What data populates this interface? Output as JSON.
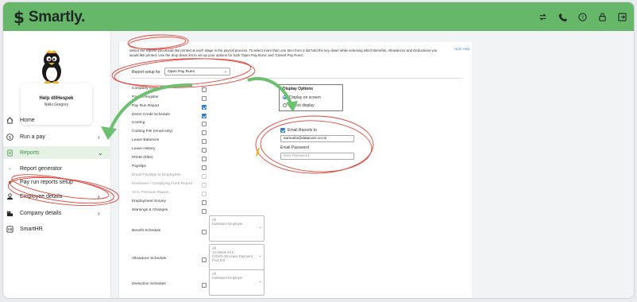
{
  "app": {
    "name": "Smartly."
  },
  "profile": {
    "company": "Help dllHespek",
    "user": "Nikki Gregory"
  },
  "nav": [
    {
      "label": "Home",
      "icon": "home-icon"
    },
    {
      "label": "Run a pay",
      "icon": "dollar-icon",
      "chevron": "›"
    },
    {
      "label": "Reports",
      "icon": "document-icon",
      "chevron": "⌄"
    },
    {
      "label": "Report generator"
    },
    {
      "label": "Pay run reports setup"
    },
    {
      "label": "Employee details",
      "icon": "person-icon",
      "chevron": "›"
    },
    {
      "label": "Company details",
      "icon": "building-icon",
      "chevron": "›"
    },
    {
      "label": "SmartHR",
      "icon": "hr-icon"
    }
  ],
  "content": {
    "intro": "Select the reports you would like printed at each stage in the payroll process. To select more than one item from a list hold the key down while selecting which Benefits, Allowances and Deductions you would like printed. Use the drop down list to set up your options for both 'Open Pay Runs' and 'Closed Pay Runs'.",
    "hide_help": "Hide Help",
    "setup_label": "Report setup for",
    "setup_value": "Open Pay Runs",
    "reports": [
      {
        "label": "Company Controls",
        "checked": false
      },
      {
        "label": "Payroll Register",
        "checked": false
      },
      {
        "label": "Pay Run Report",
        "checked": true
      },
      {
        "label": "Direct Credit Schedule",
        "checked": true
      },
      {
        "label": "Costing",
        "checked": false
      },
      {
        "label": "Costing File (email only)",
        "checked": false
      },
      {
        "label": "Leave Balances",
        "checked": false
      },
      {
        "label": "Leave History",
        "checked": false
      },
      {
        "label": "IR348 (Elite)",
        "checked": false
      },
      {
        "label": "Payslips",
        "checked": false
      },
      {
        "label": "Email Payslips to Employees",
        "checked": false,
        "disabled": true
      },
      {
        "label": "KiwiSaver / Complying Fund Report",
        "checked": false,
        "disabled": true
      },
      {
        "label": "ACC Premium Report",
        "checked": false,
        "disabled": true
      },
      {
        "label": "Employment Survey",
        "checked": false
      },
      {
        "label": "Warnings & Changes",
        "checked": false
      }
    ],
    "schedules": [
      {
        "label": "Benefit Schedule",
        "options": [
          "All",
          "KiwiSaver Employer"
        ]
      },
      {
        "label": "Allowance Schedule",
        "options": [
          "All",
          "1st Week ACC",
          "COVID-19 Leave Payment",
          "Fruit Ent"
        ]
      },
      {
        "label": "Deduction Schedule",
        "options": [
          "All",
          "KiwiSaver Employer"
        ]
      }
    ],
    "display_options": {
      "title": "Display Options",
      "opt1": "Display on screen",
      "opt2": "Do not display"
    },
    "email_reports_label": "Email Reports to",
    "email_value": "samuelo@datacom.co.nz",
    "email_password_label": "Email Password",
    "password_placeholder": "New Password"
  },
  "colors": {
    "brand": "#67b76a",
    "annotation": "#e2443b",
    "accent_arrow": "#6cc06f"
  }
}
